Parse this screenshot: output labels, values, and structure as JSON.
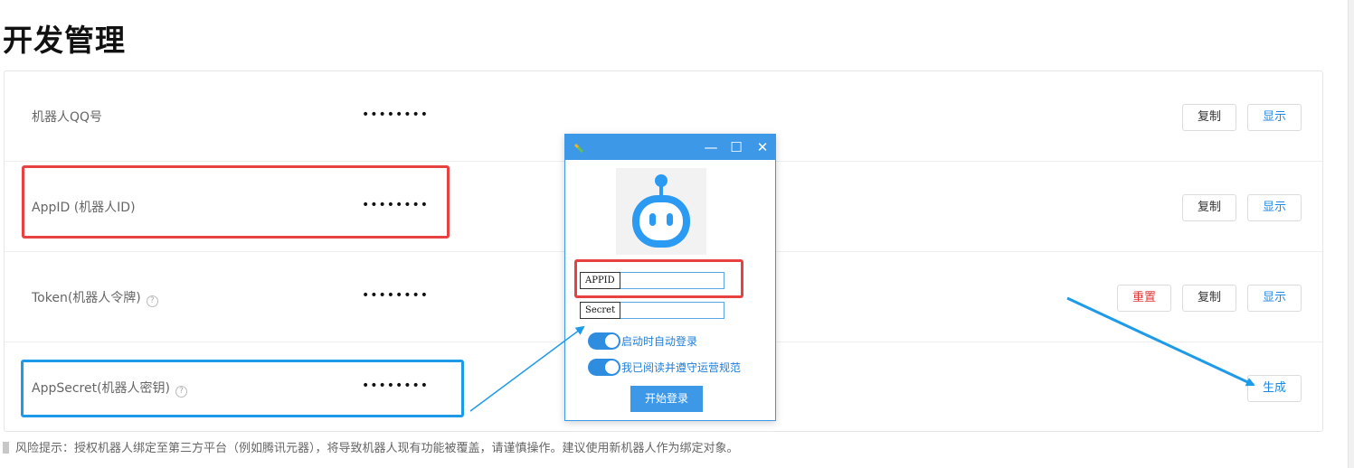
{
  "page": {
    "title": "开发管理"
  },
  "rows": [
    {
      "label": "机器人QQ号",
      "value": "••••••••",
      "has_help": false
    },
    {
      "label": "AppID (机器人ID)",
      "value": "••••••••",
      "has_help": false
    },
    {
      "label": "Token(机器人令牌)",
      "value": "••••••••",
      "has_help": true
    },
    {
      "label": "AppSecret(机器人密钥)",
      "value": "••••••••",
      "has_help": true
    }
  ],
  "buttons": {
    "copy": "复制",
    "show": "显示",
    "reset": "重置",
    "generate": "生成"
  },
  "help_glyph": "?",
  "footer": {
    "risk_note": "风险提示：授权机器人绑定至第三方平台（例如腾讯元器），将导致机器人现有功能被覆盖，请谨慎操作。建议使用新机器人作为绑定对象。"
  },
  "login_window": {
    "minimize_glyph": "—",
    "maximize_glyph": "☐",
    "close_glyph": "✕",
    "appid_label": "APPID",
    "secret_label": "Secret",
    "appid_value": "",
    "secret_value": "",
    "auto_login_label": "启动时自动登录",
    "auto_login_on": true,
    "agree_label": "我已阅读并遵守运营规范",
    "agree_on": true,
    "login_button": "开始登录"
  },
  "colors": {
    "accent": "#3d98e8",
    "highlight_red": "#e84141",
    "highlight_blue": "#1e9be8",
    "danger": "#e03a3a"
  }
}
